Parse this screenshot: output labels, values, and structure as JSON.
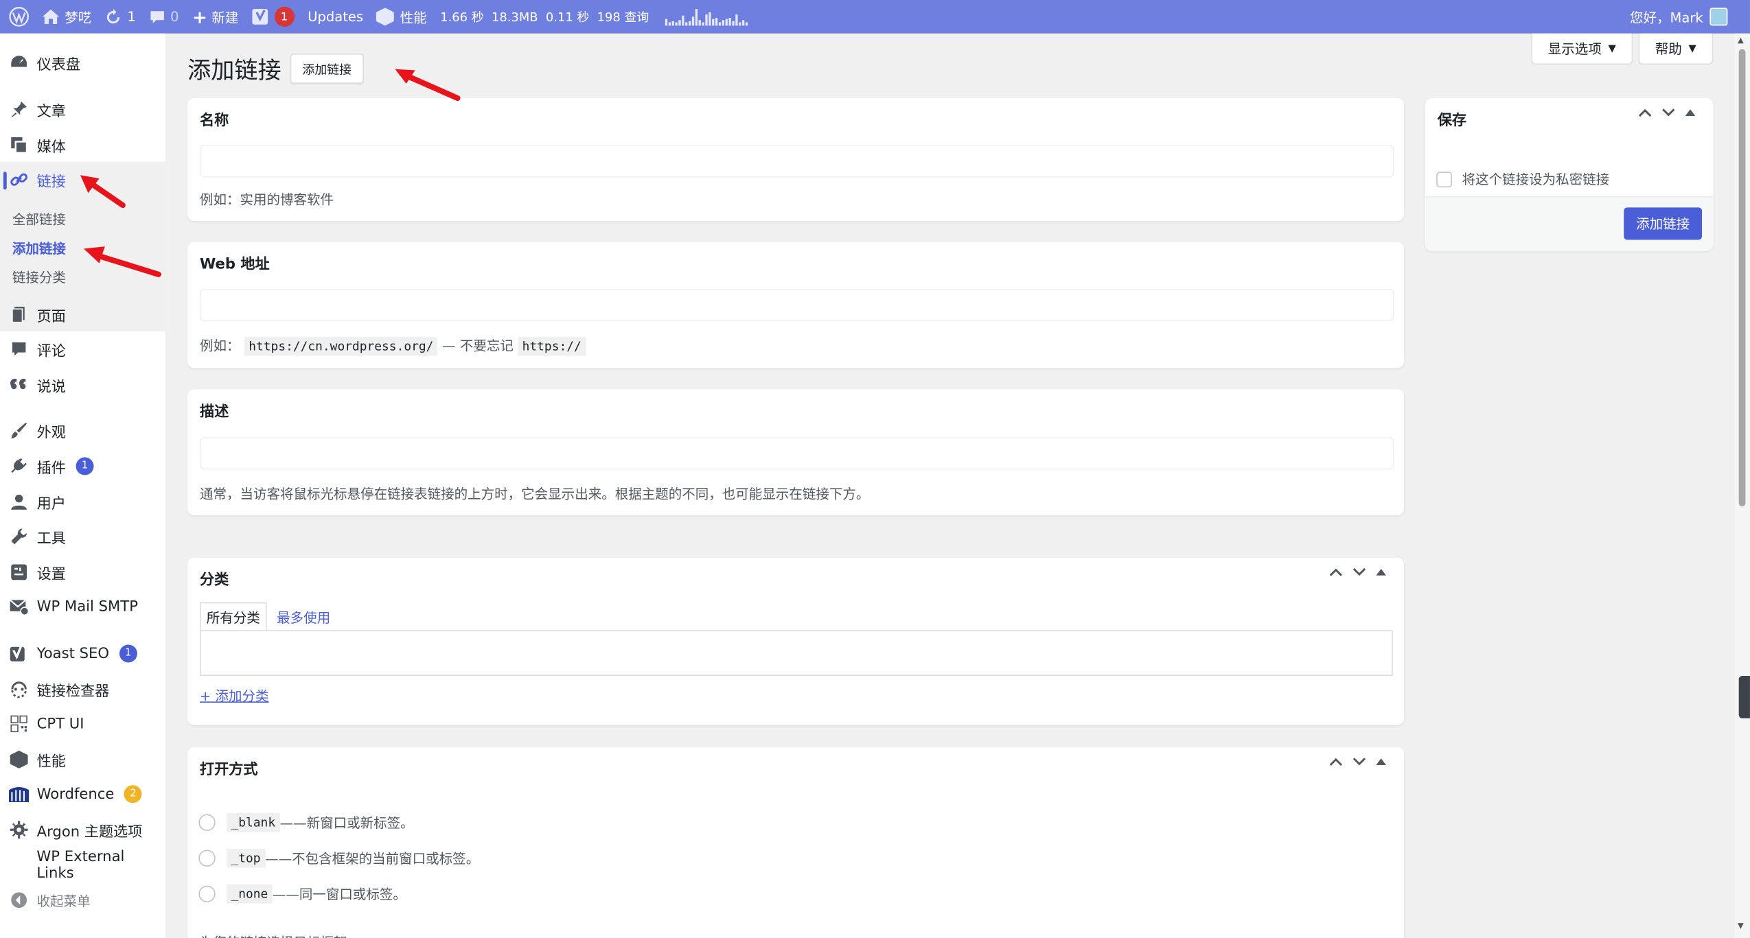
{
  "adminbar": {
    "site_name": "梦呓",
    "updates_count": "1",
    "comments_count": "0",
    "new_label": "新建",
    "yoast_count": "1",
    "updates_label": "Updates",
    "perf_label": "性能",
    "perf_time": "1.66 秒",
    "perf_memory": "18.3MB",
    "perf_query_time": "0.11 秒",
    "perf_queries": "198 查询",
    "greeting": "您好，Mark"
  },
  "screen_options": {
    "display_label": "显示选项",
    "help_label": "帮助"
  },
  "sidebar": {
    "items": [
      {
        "label": "仪表盘",
        "icon": "dashboard-icon"
      },
      {
        "label": "文章",
        "icon": "pin-icon"
      },
      {
        "label": "媒体",
        "icon": "media-icon"
      },
      {
        "label": "链接",
        "icon": "link-icon"
      },
      {
        "label": "页面",
        "icon": "page-icon"
      },
      {
        "label": "评论",
        "icon": "comment-icon"
      },
      {
        "label": "说说",
        "icon": "quote-icon"
      },
      {
        "label": "外观",
        "icon": "brush-icon"
      },
      {
        "label": "插件",
        "icon": "plugin-icon",
        "badge": "1"
      },
      {
        "label": "用户",
        "icon": "user-icon"
      },
      {
        "label": "工具",
        "icon": "wrench-icon"
      },
      {
        "label": "设置",
        "icon": "settings-icon"
      },
      {
        "label": "WP Mail SMTP",
        "icon": "mail-icon"
      },
      {
        "label": "Yoast SEO",
        "icon": "yoast-icon",
        "badge": "1"
      },
      {
        "label": "链接检查器",
        "icon": "link-checker-icon"
      },
      {
        "label": "CPT UI",
        "icon": "cpt-icon"
      },
      {
        "label": "性能",
        "icon": "performance-icon"
      },
      {
        "label": "Wordfence",
        "icon": "wordfence-icon",
        "badge": "2"
      },
      {
        "label": "Argon 主题选项",
        "icon": "gear-icon"
      },
      {
        "label": "WP External Links",
        "icon": ""
      }
    ],
    "submenu": [
      "全部链接",
      "添加链接",
      "链接分类"
    ],
    "collapse_label": "收起菜单"
  },
  "page": {
    "title": "添加链接",
    "title_button": "添加链接"
  },
  "name_box": {
    "title": "名称",
    "hint": "例如：实用的博客软件",
    "value": ""
  },
  "url_box": {
    "title": "Web 地址",
    "hint_prefix": "例如：",
    "hint_code1": "https://cn.wordpress.org/",
    "hint_mid": "— 不要忘记",
    "hint_code2": "https://",
    "value": ""
  },
  "desc_box": {
    "title": "描述",
    "hint": "通常，当访客将鼠标光标悬停在链接表链接的上方时，它会显示出来。根据主题的不同，也可能显示在链接下方。",
    "value": ""
  },
  "category_box": {
    "title": "分类",
    "tab_all": "所有分类",
    "tab_popular": "最多使用",
    "add_link": "+ 添加分类"
  },
  "target_box": {
    "title": "打开方式",
    "options": [
      {
        "code": "_blank",
        "desc": "——新窗口或新标签。"
      },
      {
        "code": "_top",
        "desc": "——不包含框架的当前窗口或标签。"
      },
      {
        "code": "_none",
        "desc": "——同一窗口或标签。"
      }
    ],
    "footer_text": "为您的链接选择目标框架。"
  },
  "save_box": {
    "title": "保存",
    "private_label": "将这个链接设为私密链接",
    "submit_label": "添加链接"
  },
  "colors": {
    "admin_bar": "#6f7fe0",
    "accent": "#4a5ed8",
    "annotation_arrow": "#e8141c"
  }
}
